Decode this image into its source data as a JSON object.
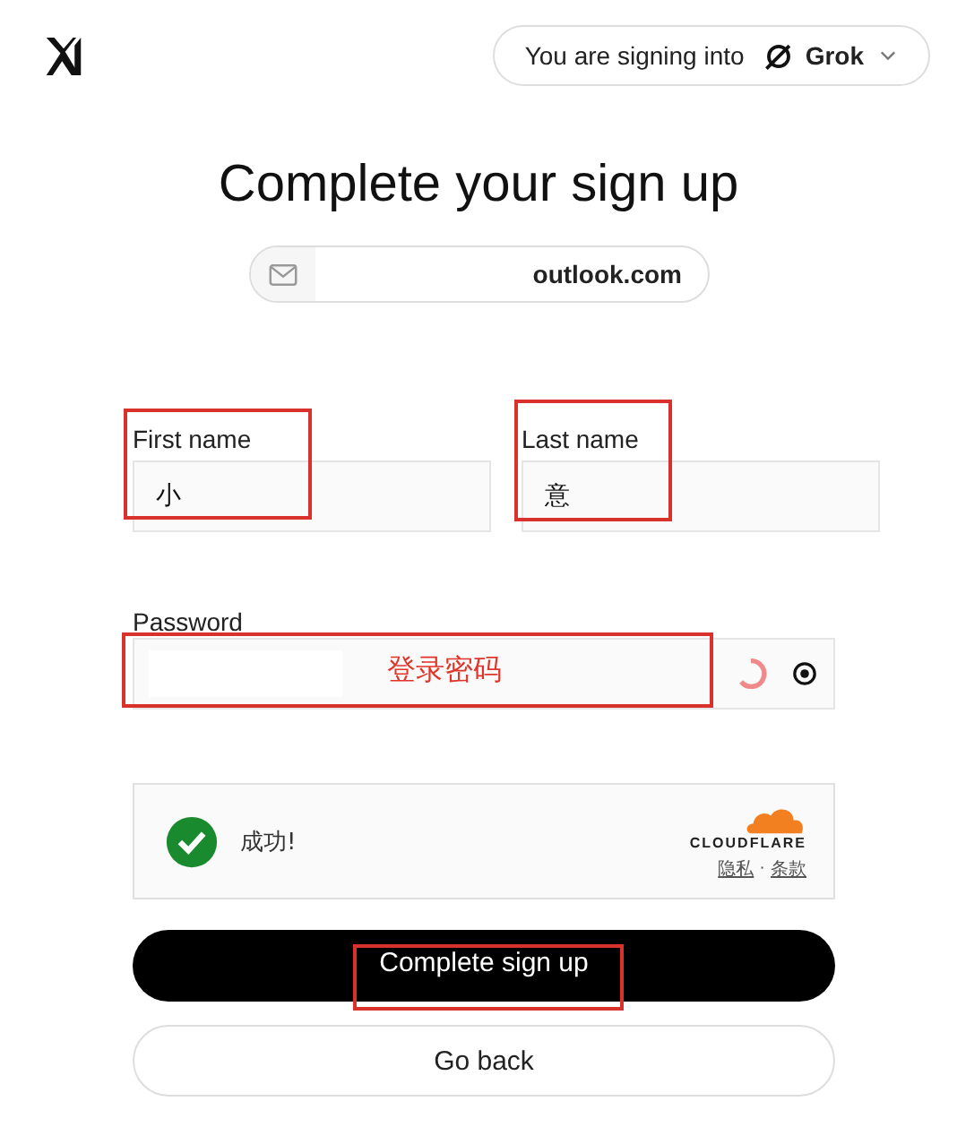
{
  "header": {
    "signing_into": {
      "label": "You are signing into",
      "app": "Grok"
    }
  },
  "title": "Complete your sign up",
  "email": {
    "value": "outlook.com"
  },
  "name_fields": [
    {
      "label": "First name",
      "value": "小",
      "annotated": true
    },
    {
      "label": "Last name",
      "value": "意",
      "annotated": true
    }
  ],
  "password": {
    "label": "Password",
    "loading": true,
    "annotation": "登录密码"
  },
  "captcha": {
    "status": "成功!",
    "verified": true,
    "brand": "CLOUDFLARE",
    "links": [
      "隐私",
      "条款"
    ],
    "separator": "·"
  },
  "buttons": [
    {
      "label": "Complete sign up",
      "kind": "primary",
      "annotated": true
    },
    {
      "label": "Go back",
      "kind": "secondary",
      "annotated": false
    }
  ]
}
